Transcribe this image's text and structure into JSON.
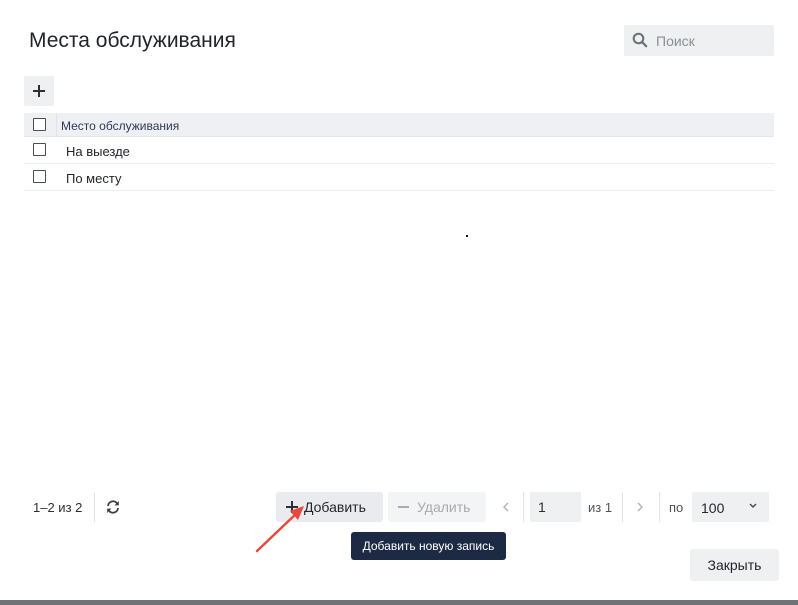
{
  "dialog": {
    "title": "Места обслуживания",
    "search": {
      "placeholder": "Поиск",
      "value": "",
      "icon": "search-icon"
    }
  },
  "toolbar": {
    "add_icon": "plus-icon"
  },
  "table": {
    "columns": [
      "Место обслуживания"
    ],
    "rows": [
      {
        "label": "На выезде",
        "checked": false
      },
      {
        "label": "По месту",
        "checked": false
      }
    ]
  },
  "pager": {
    "count_text": "1–2 из 2",
    "add_label": "Добавить",
    "delete_label": "Удалить",
    "page_value": "1",
    "of_total": "из 1",
    "per_label": "по",
    "per_value": "100"
  },
  "tooltip": {
    "text": "Добавить новую запись"
  },
  "footer": {
    "close_label": "Закрыть"
  },
  "colors": {
    "tooltip_bg": "#1c2a44",
    "annotation_arrow": "#e8473a",
    "header_bg": "#eef0f3"
  }
}
